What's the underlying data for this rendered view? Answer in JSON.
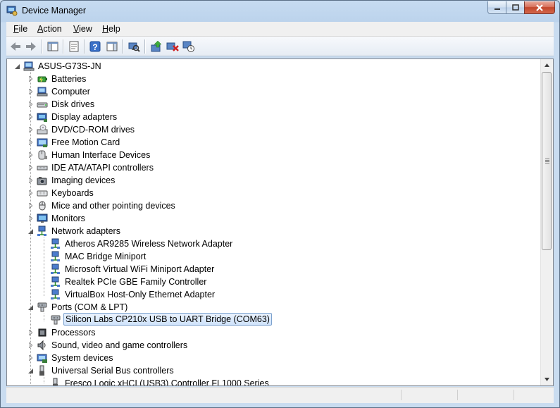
{
  "window": {
    "title": "Device Manager"
  },
  "menu": [
    {
      "key": "F",
      "rest": "ile"
    },
    {
      "key": "A",
      "rest": "ction"
    },
    {
      "key": "V",
      "rest": "iew"
    },
    {
      "key": "H",
      "rest": "elp"
    }
  ],
  "tree": {
    "root": "ASUS-G73S-JN",
    "categories": [
      "Batteries",
      "Computer",
      "Disk drives",
      "Display adapters",
      "DVD/CD-ROM drives",
      "Free Motion Card",
      "Human Interface Devices",
      "IDE ATA/ATAPI controllers",
      "Imaging devices",
      "Keyboards",
      "Mice and other pointing devices",
      "Monitors",
      "Network adapters"
    ],
    "network_adapters": [
      "Atheros AR9285 Wireless Network Adapter",
      "MAC Bridge Miniport",
      "Microsoft Virtual WiFi Miniport Adapter",
      "Realtek PCIe GBE Family Controller",
      "VirtualBox Host-Only Ethernet Adapter"
    ],
    "ports": "Ports (COM & LPT)",
    "ports_children": [
      "Silicon Labs CP210x USB to UART Bridge (COM63)"
    ],
    "more_categories": [
      "Processors",
      "Sound, video and game controllers",
      "System devices"
    ],
    "usb": "Universal Serial Bus controllers",
    "usb_children": [
      "Fresco Logic xHCI (USB3) Controller FL1000 Series"
    ]
  },
  "selected": "Silicon Labs CP210x USB to UART Bridge (COM63)",
  "colors": {
    "selection_border": "#7da2ce",
    "selection_fill": "#cfe3fb",
    "close_button": "#c2452b"
  }
}
